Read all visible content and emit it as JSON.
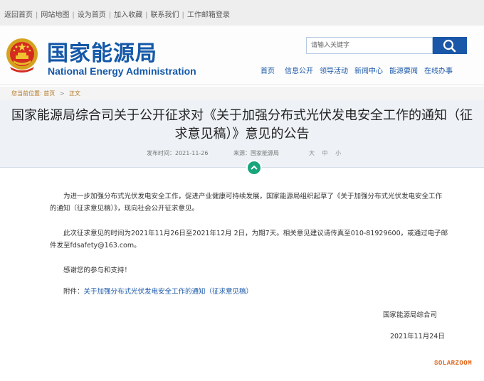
{
  "topbar": {
    "links": [
      "返回首页",
      "网站地图",
      "设为首页",
      "加入收藏",
      "联系我们",
      "工作邮箱登录"
    ]
  },
  "header": {
    "logo_cn": "国家能源局",
    "logo_en": "National Energy Administration",
    "search_placeholder": "请输入关键字",
    "nav": [
      "首页",
      "信息公开",
      "领导活动",
      "新闻中心",
      "能源要闻",
      "在线办事"
    ]
  },
  "breadcrumb": {
    "label": "您当前位置:",
    "home": "首页",
    "current": "正文"
  },
  "article": {
    "title": "国家能源局综合司关于公开征求对《关于加强分布式光伏发电安全工作的通知（征求意见稿）》意见的公告",
    "date": "发布时间：2021-11-26",
    "source": "来源：国家能源局",
    "font_size_label": "大 中 小",
    "para1": "为进一步加强分布式光伏发电安全工作，促进产业健康可持续发展，国家能源局组织起草了《关于加强分布式光伏发电安全工作的通知（征求意见稿）》，现向社会公开征求意见。",
    "para2": "此次征求意见的时间为2021年11月26日至2021年12月 2日，为期7天。相关意见建议请传真至010-81929600，或通过电子邮件发至fdsafety@163.com。",
    "para3": "感谢您的参与和支持！",
    "attach_label": "附件：",
    "attach_link": "关于加强分布式光伏发电安全工作的通知（征求意见稿）",
    "signature": "国家能源局综合司",
    "sign_date": "2021年11月24日"
  },
  "watermark": "SOLARZOOM",
  "colors": {
    "brand_blue": "#1458a8",
    "crumb": "#b47a2a",
    "collapse_green": "#18a57b",
    "watermark": "#e0641a"
  }
}
